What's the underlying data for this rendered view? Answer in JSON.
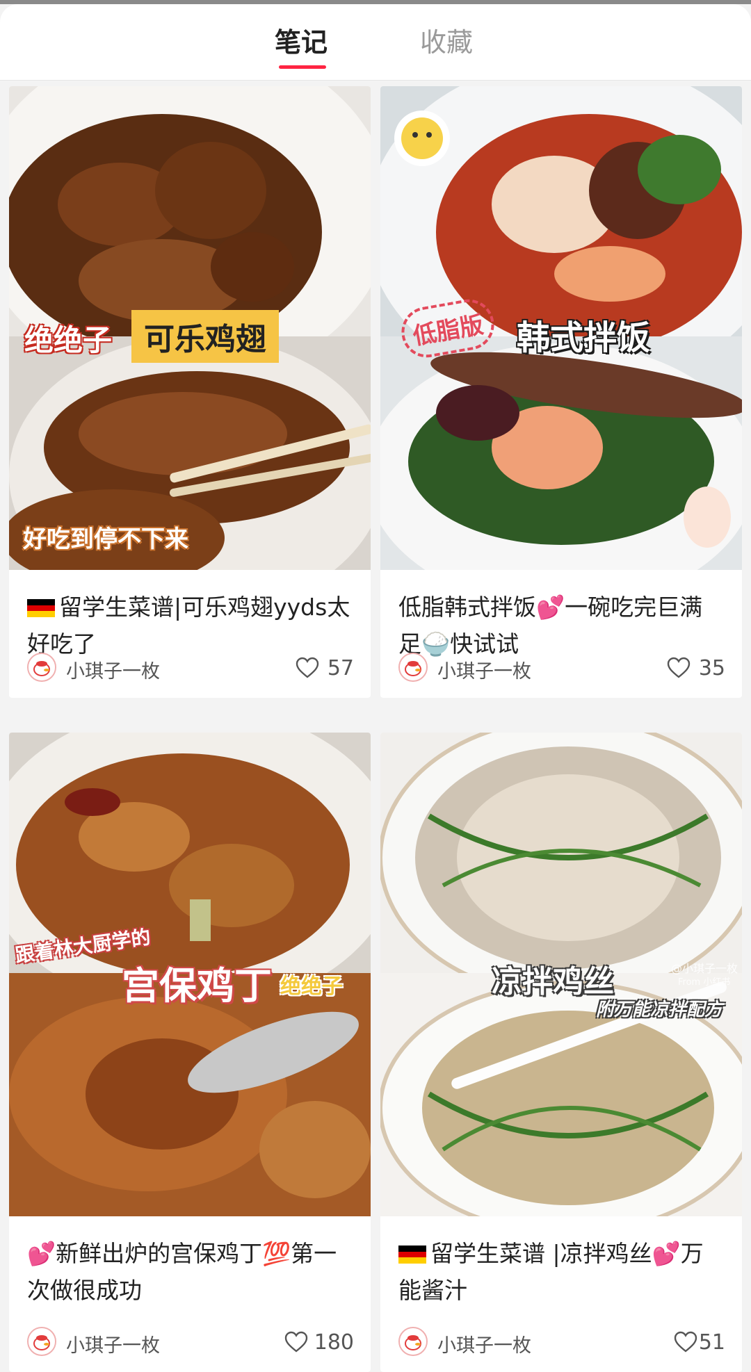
{
  "tabs": {
    "notes": "笔记",
    "favorites": "收藏",
    "active": "notes"
  },
  "accent_color": "#ff2442",
  "cards": [
    {
      "flag": "germany-flag",
      "title_text": "留学生菜谱|可乐鸡翅yyds太好吃了",
      "author": "小琪子一枚",
      "likes": "57",
      "cover_text": {
        "left_label": "绝绝子",
        "main_label": "可乐鸡翅",
        "bottom_label": "好吃到停不下来"
      }
    },
    {
      "title_text": "低脂韩式拌饭💕一碗吃完巨满足🍚快试试",
      "author": "小琪子一枚",
      "likes": "35",
      "cover_text": {
        "stamp": "低脂版",
        "main_label": "韩式拌饭"
      }
    },
    {
      "title_text": "💕新鲜出炉的宫保鸡丁💯第一次做很成功",
      "author": "小琪子一枚",
      "likes": "180",
      "cover_text": {
        "top_label": "跟着林大厨学的",
        "main_label": "宫保鸡丁",
        "side_label": "绝绝子"
      }
    },
    {
      "flag": "germany-flag",
      "title_text": "留学生菜谱 |凉拌鸡丝💕万能酱汁",
      "author": "小琪子一枚",
      "likes": "51",
      "cover_text": {
        "main_label": "凉拌鸡丝",
        "sub_label": "附万能凉拌配方",
        "watermark": "@小琪子一枚",
        "watermark2": "From 小红书"
      }
    }
  ]
}
